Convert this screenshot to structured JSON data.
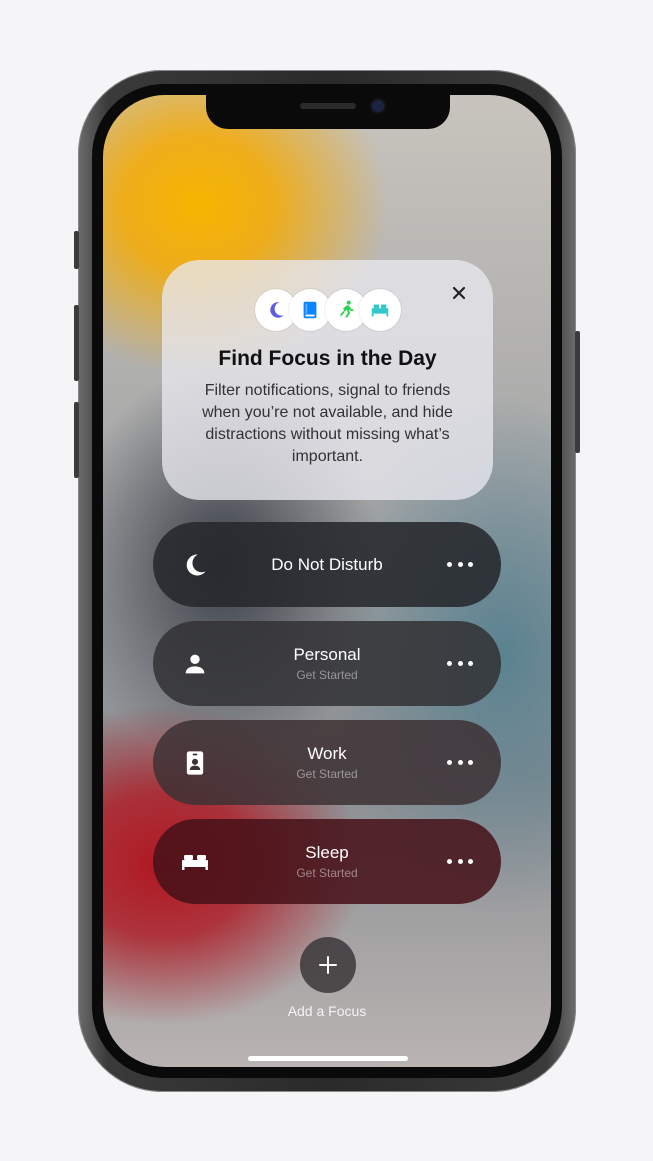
{
  "card": {
    "title": "Find Focus in the Day",
    "body": "Filter notifications, signal to friends when you’re not available, and hide distractions without missing what’s important.",
    "icons": [
      "moon-icon",
      "book-icon",
      "running-icon",
      "bed-icon"
    ],
    "icon_colors": [
      "#5e5ce6",
      "#0a84ff",
      "#30d158",
      "#30c8c8"
    ]
  },
  "focus_items": [
    {
      "title": "Do Not Disturb",
      "subtitle": "",
      "icon": "moon-icon"
    },
    {
      "title": "Personal",
      "subtitle": "Get Started",
      "icon": "person-icon"
    },
    {
      "title": "Work",
      "subtitle": "Get Started",
      "icon": "id-badge-icon"
    },
    {
      "title": "Sleep",
      "subtitle": "Get Started",
      "icon": "bed-icon"
    }
  ],
  "add_focus": {
    "label": "Add a Focus"
  }
}
